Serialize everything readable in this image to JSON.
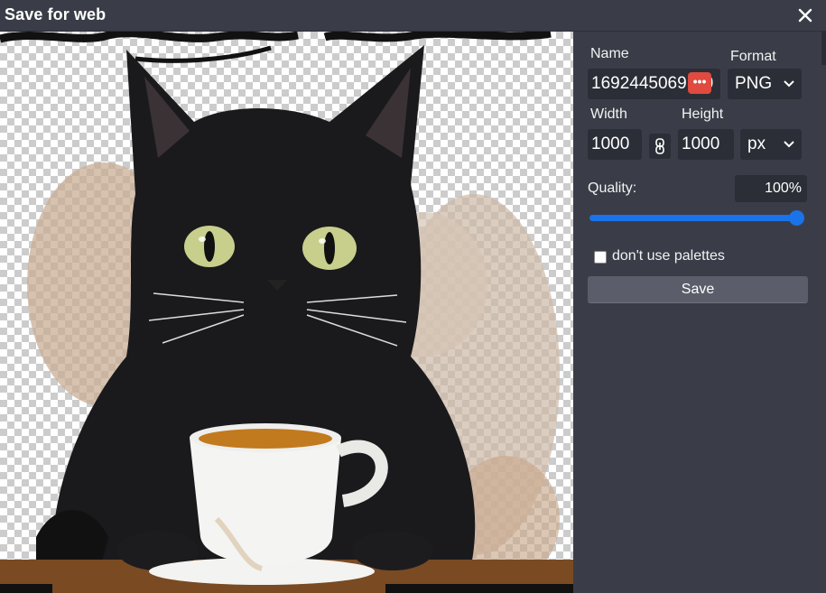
{
  "window": {
    "title": "Save for web"
  },
  "preview": {
    "image_description_icon": "watercolor-black-cat-with-coffee-cup"
  },
  "panel": {
    "name_label": "Name",
    "name_value": "1692445069…0",
    "format_label": "Format",
    "format_value": "PNG",
    "width_label": "Width",
    "width_value": "1000",
    "height_label": "Height",
    "height_value": "1000",
    "unit_value": "px",
    "quality_label": "Quality:",
    "quality_value": "100%",
    "quality_level": 1.0,
    "palette_checkbox_label": "don't use palettes",
    "palette_checked": false,
    "save_label": "Save",
    "more_badge": "•••"
  },
  "colors": {
    "accent": "#1a73e8",
    "panel_bg": "#3a3d47",
    "field_bg": "#2b2e36",
    "badge": "#e04a3f"
  }
}
